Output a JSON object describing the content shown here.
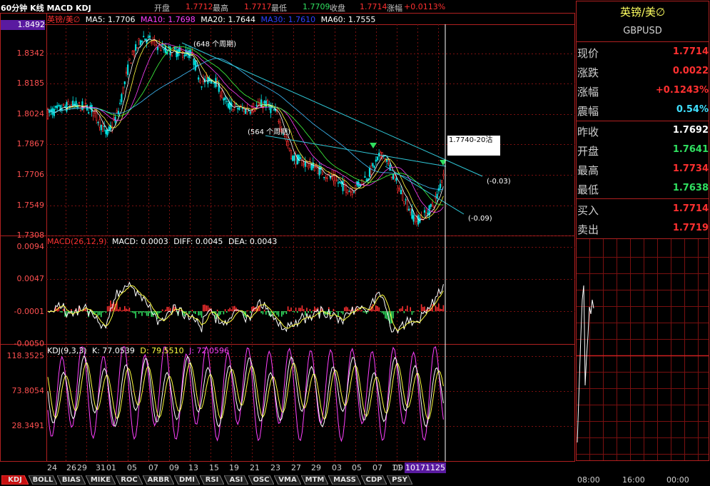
{
  "header": {
    "period_label": "60分钟 K线 MACD KDJ",
    "open_label": "开盘",
    "open_value": "1.7712",
    "high_label": "最高",
    "high_value": "1.7717",
    "low_label": "最低",
    "low_value": "1.7709",
    "close_label": "收盘",
    "close_value": "1.7714",
    "change_label": "涨幅",
    "change_value": "+0.0113%"
  },
  "price_panel": {
    "legend_name": "英镑/美∅",
    "ma5": "MA5: 1.7706",
    "ma10": "MA10: 1.7698",
    "ma20": "MA20: 1.7644",
    "ma30": "MA30: 1.7610",
    "ma60": "MA60: 1.7555",
    "current_price_tag": "1.8492",
    "y_ticks": [
      "1.8342",
      "1.8185",
      "1.8024",
      "1.7867",
      "1.7706",
      "1.7549",
      "1.7308"
    ],
    "annotation_648": "(648 个周期)",
    "annotation_564": "(564 个周期)",
    "tooltip": "1.7740-20沽",
    "trend_label_1": "(-0.03)",
    "trend_label_2": "(-0.09)",
    "colors": {
      "up": "#ff3030",
      "down": "#00e0e0",
      "trend": "#30c8d8",
      "arrow": "#30e060"
    }
  },
  "macd_panel": {
    "title": "MACD(26,12,9)",
    "macd": "MACD: 0.0003",
    "diff": "DIFF: 0.0045",
    "dea": "DEA: 0.0043",
    "y_ticks": [
      "0.0094",
      "0.0047",
      "-0.0001",
      "-0.0050"
    ]
  },
  "kdj_panel": {
    "title": "KDJ(9,3,3)",
    "k": "K: 77.0539",
    "d": "D: 79.5510",
    "j": "J: 72.0596",
    "y_ticks": [
      "118.3525",
      "73.8054",
      "28.3491"
    ]
  },
  "x_axis": {
    "labels": [
      "24",
      "26",
      "29",
      "31",
      "01",
      "05",
      "07",
      "09",
      "13",
      "15",
      "19",
      "21",
      "23",
      "27",
      "29",
      "03",
      "05",
      "07",
      "09",
      "11"
    ],
    "highlight": "10171125"
  },
  "tabs": [
    "KDJ",
    "BOLL",
    "BIAS",
    "MIKE",
    "ROC",
    "ARBR",
    "DMI",
    "RSI",
    "ASI",
    "OSC",
    "VMA",
    "MTM",
    "MASS",
    "CDP",
    "PSY"
  ],
  "quote_panel": {
    "name": "英镑/美∅",
    "code": "GBPUSD",
    "rows": [
      {
        "label": "现价",
        "value": "1.7714",
        "color": "#ff3030"
      },
      {
        "label": "涨跌",
        "value": "0.0022",
        "color": "#ff3030"
      },
      {
        "label": "涨幅",
        "value": "+0.1243%",
        "color": "#ff3030"
      },
      {
        "label": "震幅",
        "value": "0.54%",
        "color": "#40e0ff"
      },
      {
        "label": "昨收",
        "value": "1.7692",
        "color": "#ffffff"
      },
      {
        "label": "开盘",
        "value": "1.7641",
        "color": "#30e060"
      },
      {
        "label": "最高",
        "value": "1.7734",
        "color": "#ff3030"
      },
      {
        "label": "最低",
        "value": "1.7638",
        "color": "#30e060"
      },
      {
        "label": "买入",
        "value": "1.7714",
        "color": "#ff3030"
      },
      {
        "label": "卖出",
        "value": "1.7719",
        "color": "#ff3030"
      }
    ],
    "time_ticks": [
      "08:00",
      "16:00",
      "00:00"
    ]
  }
}
